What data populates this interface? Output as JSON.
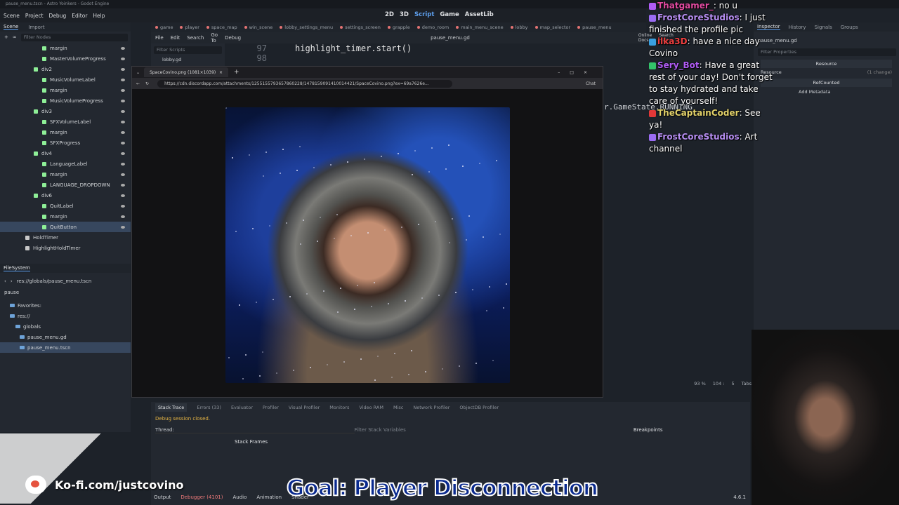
{
  "window": {
    "title": "pause_menu.tscn - Astro Yoinkers - Godot Engine"
  },
  "menubar": {
    "items": [
      "Scene",
      "Project",
      "Debug",
      "Editor",
      "Help"
    ]
  },
  "workspaces": [
    "2D",
    "3D",
    "Script",
    "Game",
    "AssetLib"
  ],
  "scene_dock": {
    "tabs": [
      "Scene",
      "Import"
    ],
    "filter_placeholder": "Filter Nodes",
    "nodes": [
      {
        "label": "margin",
        "indent": 60,
        "color": "green"
      },
      {
        "label": "MasterVolumeProgress",
        "indent": 60,
        "color": "green"
      },
      {
        "label": "div2",
        "indent": 48,
        "color": "green"
      },
      {
        "label": "MusicVolumeLabel",
        "indent": 60,
        "color": "green"
      },
      {
        "label": "margin",
        "indent": 60,
        "color": "green"
      },
      {
        "label": "MusicVolumeProgress",
        "indent": 60,
        "color": "green"
      },
      {
        "label": "div3",
        "indent": 48,
        "color": "green"
      },
      {
        "label": "SFXVolumeLabel",
        "indent": 60,
        "color": "green"
      },
      {
        "label": "margin",
        "indent": 60,
        "color": "green"
      },
      {
        "label": "SFXProgress",
        "indent": 60,
        "color": "green"
      },
      {
        "label": "div4",
        "indent": 48,
        "color": "green"
      },
      {
        "label": "LanguageLabel",
        "indent": 60,
        "color": "green"
      },
      {
        "label": "margin",
        "indent": 60,
        "color": "green"
      },
      {
        "label": "LANGUAGE_DROPDOWN",
        "indent": 60,
        "color": "green"
      },
      {
        "label": "div6",
        "indent": 48,
        "color": "green"
      },
      {
        "label": "QuitLabel",
        "indent": 60,
        "color": "green"
      },
      {
        "label": "margin",
        "indent": 60,
        "color": "green"
      },
      {
        "label": "QuitButton",
        "indent": 60,
        "color": "green",
        "selected": true
      },
      {
        "label": "HoldTimer",
        "indent": 36,
        "color": "gray"
      },
      {
        "label": "HighlightHoldTimer",
        "indent": 36,
        "color": "gray"
      }
    ]
  },
  "filesystem": {
    "title": "FileSystem",
    "path": "res://globals/pause_menu.tscn",
    "search": "pause",
    "items": [
      {
        "label": "Favorites:",
        "indent": 14
      },
      {
        "label": "res://",
        "indent": 14
      },
      {
        "label": "globals",
        "indent": 22
      },
      {
        "label": "pause_menu.gd",
        "indent": 28
      },
      {
        "label": "pause_menu.tscn",
        "indent": 28,
        "selected": true
      }
    ]
  },
  "scene_tabs": [
    "game",
    "player",
    "space_map",
    "win_scene",
    "lobby_settings_menu",
    "settings_screen",
    "grapple",
    "demo_room",
    "main_menu_scene",
    "lobby",
    "map_selector",
    "pause_menu"
  ],
  "script_menu": {
    "items": [
      "File",
      "Edit",
      "Search",
      "Go To",
      "Debug"
    ],
    "current_file": "pause_menu.gd",
    "online_docs": "Online Docs",
    "search_help": "Search Help"
  },
  "script_list": {
    "filter_placeholder": "Filter Scripts",
    "first_item": "lobby.gd"
  },
  "code": {
    "lines": [
      {
        "num": "97",
        "text": "highlight_timer.start()"
      },
      {
        "num": "98",
        "text": ""
      }
    ],
    "fragment": "r.GameState.RUNNING"
  },
  "editor_status": {
    "zoom": "93 %",
    "line": "104 :",
    "col": "5",
    "indent": "Tabs"
  },
  "browser": {
    "tab_title": "SpaceCovino.png (1081×1039)",
    "url": "https://cdn.discordapp.com/attachments/1255155793657860228/1478159091410014421/SpaceCovino.png?ex=69a7626e...",
    "chat_label": "Chat"
  },
  "inspector": {
    "tabs": [
      "Inspector",
      "History",
      "Signals",
      "Groups"
    ],
    "file": "pause_menu.gd",
    "filter_placeholder": "Filter Properties",
    "resource_label": "Resource",
    "resource_row": "Resource",
    "change_count": "(1 change)",
    "refcounted": "RefCounted",
    "add_metadata": "Add Metadata"
  },
  "chat": [
    {
      "user": "Thatgamer_",
      "color": "#e24aa0",
      "msg": "no u",
      "badge": "#b05cf5"
    },
    {
      "user": "FrostCoreStudios",
      "color": "#b58df0",
      "msg": "I just finished the profile pic",
      "badge": "#9b6cf3"
    },
    {
      "user": "ilka3D",
      "color": "#ef3f3f",
      "msg": "have a nice day Covino",
      "badge": "#3aa0e0"
    },
    {
      "user": "Sery_Bot",
      "color": "#b05cf5",
      "msg": "Have a great rest of your day! Don't forget to stay hydrated and take care of yourself!",
      "badge": "#33c36a"
    },
    {
      "user": "TheCaptainCoder",
      "color": "#e3d26a",
      "msg": "See ya!",
      "badge": "#e23838"
    },
    {
      "user": "FrostCoreStudios",
      "color": "#b58df0",
      "msg": "Art channel",
      "badge": "#9b6cf3"
    }
  ],
  "bottom_panel": {
    "tabs": [
      "Stack Trace",
      "Errors (33)",
      "Evaluator",
      "Profiler",
      "Visual Profiler",
      "Monitors",
      "Video RAM",
      "Misc",
      "Network Profiler",
      "ObjectDB Profiler"
    ],
    "status": "Debug session closed.",
    "thread_label": "Thread:",
    "filter_placeholder": "Filter Stack Variables",
    "stack_frames": "Stack Frames",
    "breakpoints": "Breakpoints"
  },
  "panel_bar": {
    "items": [
      "Output",
      "Debugger (4101)",
      "Audio",
      "Animation",
      "Shader"
    ],
    "version": "4.6.1"
  },
  "overlay": {
    "kofi": "Ko-fi.com/justcovino",
    "goal": "Goal: Player Disconnection"
  }
}
